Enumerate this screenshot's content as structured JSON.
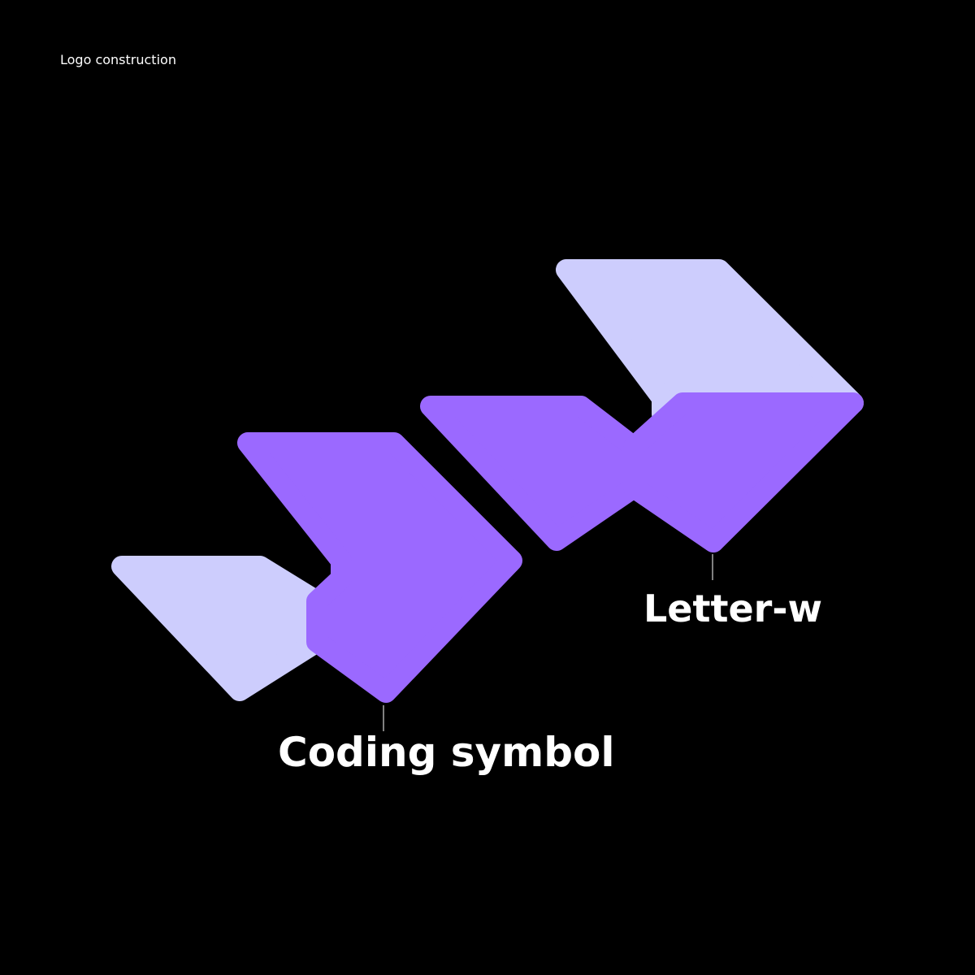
{
  "page": {
    "title": "Logo construction"
  },
  "labels": {
    "coding_symbol": "Coding symbol",
    "letter_w": "Letter-w"
  },
  "colors": {
    "background": "#000000",
    "light_lavender": "#cdcdfd",
    "violet": "#9b69ff",
    "text": "#ffffff"
  }
}
